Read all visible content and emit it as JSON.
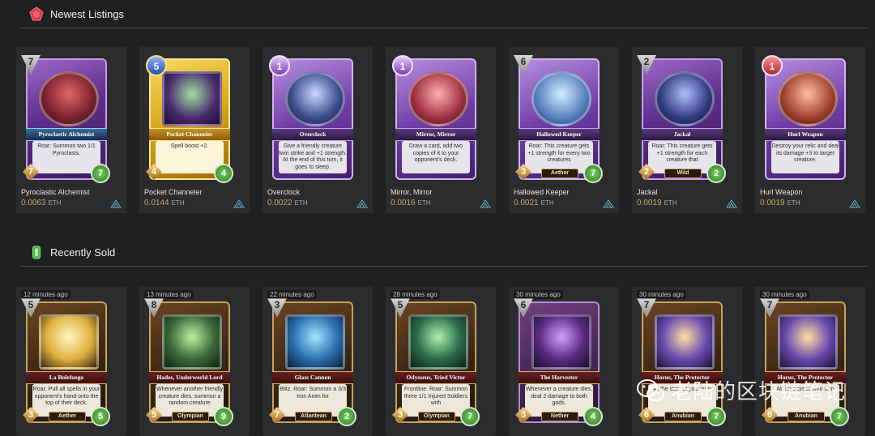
{
  "sections": {
    "newest": {
      "title": "Newest Listings",
      "icon": "pentagon-gem-icon",
      "color": "#d8384a"
    },
    "sold": {
      "title": "Recently Sold",
      "icon": "battery-gem-icon",
      "color": "#49b24a"
    }
  },
  "listings": [
    {
      "name": "Pyroclastic Alchemist",
      "card_title": "Pyroclastic Alchemist",
      "price": "0.0063",
      "unit": "ETH",
      "cost": "7",
      "attack": "7",
      "health": "7",
      "text": "Roar: Summon two 1/1 Pyroclasts.",
      "tribe": ""
    },
    {
      "name": "Pocket Channeler",
      "card_title": "Pocket Channeler",
      "price": "0.0144",
      "unit": "ETH",
      "cost": "5",
      "attack": "4",
      "health": "4",
      "text": "Spell boost +2.",
      "tribe": ""
    },
    {
      "name": "Overclock",
      "card_title": "Overclock",
      "price": "0.0022",
      "unit": "ETH",
      "cost": "1",
      "attack": "",
      "health": "",
      "text": "Give a friendly creature twin strike and +1 strength. At the end of this turn, it goes to sleep.",
      "tribe": ""
    },
    {
      "name": "Mirror, Mirror",
      "card_title": "Mirror, Mirror",
      "price": "0.0016",
      "unit": "ETH",
      "cost": "1",
      "attack": "",
      "health": "",
      "text": "Draw a card, add two copies of it to your opponent's deck.",
      "tribe": ""
    },
    {
      "name": "Hallowed Keeper",
      "card_title": "Hallowed Keeper",
      "price": "0.0021",
      "unit": "ETH",
      "cost": "6",
      "attack": "3",
      "health": "7",
      "text": "Roar: This creature gets +1 strength for every two creatures",
      "tribe": "Aether"
    },
    {
      "name": "Jackal",
      "card_title": "Jackal",
      "price": "0.0019",
      "unit": "ETH",
      "cost": "2",
      "attack": "2",
      "health": "2",
      "text": "Roar: This creature gets +1 strength for each creature that",
      "tribe": "Wild"
    },
    {
      "name": "Hurl Weapon",
      "card_title": "Hurl Weapon",
      "price": "0.0019",
      "unit": "ETH",
      "cost": "1",
      "attack": "",
      "health": "",
      "text": "Destroy your relic and deal its damage +3 to target creature.",
      "tribe": ""
    }
  ],
  "sold": [
    {
      "time": "12 minutes ago",
      "card_title": "La Bolefuego",
      "cost": "5",
      "attack": "3",
      "health": "5",
      "text": "Roar: Pull all spells in your opponent's hand onto the top of their deck.",
      "tribe": "Aether"
    },
    {
      "time": "13 minutes ago",
      "card_title": "Hades, Underworld Lord",
      "cost": "8",
      "attack": "5",
      "health": "9",
      "text": "Whenever another friendly creature dies, summon a random creature",
      "tribe": "Olympian"
    },
    {
      "time": "22 minutes ago",
      "card_title": "Glass Cannon",
      "cost": "3",
      "attack": "7",
      "health": "2",
      "text": "Blitz. Roar: Summon a 3/3 Iron Anim for",
      "tribe": "Atlantean"
    },
    {
      "time": "28 minutes ago",
      "card_title": "Odysseus, Tried Victor",
      "cost": "5",
      "attack": "3",
      "health": "7",
      "text": "Frontline. Roar: Summon three 1/1 Injured Soldiers with",
      "tribe": "Olympian"
    },
    {
      "time": "30 minutes ago",
      "card_title": "The Harvester",
      "cost": "6",
      "attack": "3",
      "health": "4",
      "text": "Whenever a creature dies, deal 2 damage to both gods.",
      "tribe": "Nether"
    },
    {
      "time": "30 minutes ago",
      "card_title": "Horus, The Protector",
      "cost": "7",
      "attack": "6",
      "health": "7",
      "text": "At the start of your turn",
      "tribe": "Anubian"
    },
    {
      "time": "30 minutes ago",
      "card_title": "Horus, The Protector",
      "cost": "7",
      "attack": "6",
      "health": "7",
      "text": "At the start of your turn",
      "tribe": "Anubian"
    }
  ],
  "watermark": {
    "text": "老陆的区块链笔记",
    "icon": "wechat-icon"
  }
}
